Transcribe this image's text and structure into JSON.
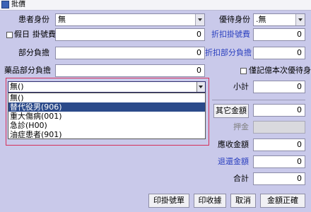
{
  "window": {
    "title": "批價"
  },
  "form": {
    "patient_identity": {
      "label": "患者身份",
      "value": "無"
    },
    "discount_identity": {
      "label": "優待身份",
      "value": ".無"
    },
    "holiday_label": "假日",
    "registration_fee": {
      "label": "掛號費",
      "value": "0"
    },
    "discount_registration_fee": {
      "label": "折扣掛號費",
      "value": "0"
    },
    "copayment": {
      "label": "部分負擔",
      "value": "0"
    },
    "discount_copayment": {
      "label": "折扣部分負擔",
      "value": "0"
    },
    "drug_copayment": {
      "label": "藥品部分負擔",
      "value": "0"
    },
    "memo_discount_label": "僅記億本次優待身份",
    "subtotal": {
      "label": "小計",
      "value": "0"
    },
    "other_amount": {
      "label": "其它金額",
      "value": "0"
    },
    "deposit": {
      "label": "押金",
      "value": ""
    },
    "receivable": {
      "label": "應收金額",
      "value": "0"
    },
    "refund": {
      "label": "退還金額",
      "value": "0"
    },
    "total": {
      "label": "合計",
      "value": "0"
    }
  },
  "dropdown": {
    "selected": "無()",
    "options": [
      "無()",
      "替代役男(906)",
      "重大傷病(001)",
      "急診(H00)",
      "油症患者(901)"
    ],
    "highlighted_index": 1
  },
  "buttons": {
    "print_registration": "印掛號單",
    "print_receipt": "印收據",
    "cancel": "取消",
    "confirm_amount": "金額正確"
  },
  "colors": {
    "background": "#c9c9ea",
    "highlight": "#2b4a8a",
    "focus_border": "#d5305b",
    "link_blue": "#2a3fbf"
  }
}
